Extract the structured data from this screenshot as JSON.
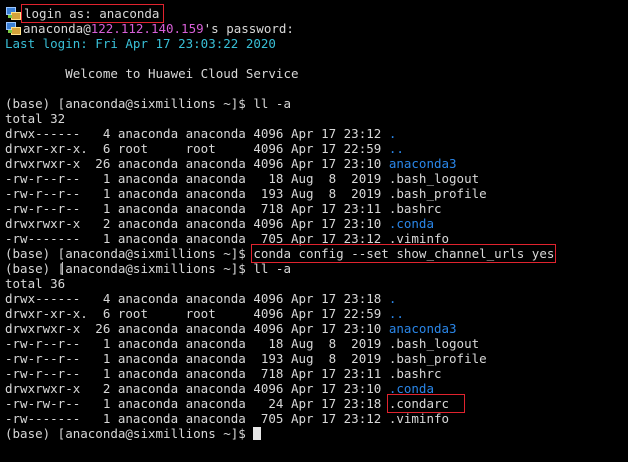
{
  "terminal": {
    "colors": {
      "background": "#000000",
      "text": "#d8d8d8",
      "ip": "#d75fd7",
      "last_login": "#39bfd6",
      "directory": "#2a86e8",
      "highlight_box": "#e0232e"
    },
    "login_line": "login as: anaconda",
    "pw_user": "anaconda@",
    "pw_ip": "122.112.140.159",
    "pw_suffix": "'s password:",
    "last_login": "Last login: Fri Apr 17 23:03:22 2020",
    "welcome": "        Welcome to Huawei Cloud Service",
    "prompt": "(base) [anaconda@sixmillions ~]$ ",
    "cmd1": "ll -a",
    "total1": "total 32",
    "listing1": [
      {
        "meta": "drwx------   4 anaconda anaconda 4096 Apr 17 23:12 ",
        "name": ".",
        "color": "dir"
      },
      {
        "meta": "drwxr-xr-x.  6 root     root     4096 Apr 17 22:59 ",
        "name": "..",
        "color": "dir"
      },
      {
        "meta": "drwxrwxr-x  26 anaconda anaconda 4096 Apr 17 23:10 ",
        "name": "anaconda3",
        "color": "dir"
      },
      {
        "meta": "-rw-r--r--   1 anaconda anaconda   18 Aug  8  2019 ",
        "name": ".bash_logout",
        "color": "plain"
      },
      {
        "meta": "-rw-r--r--   1 anaconda anaconda  193 Aug  8  2019 ",
        "name": ".bash_profile",
        "color": "plain"
      },
      {
        "meta": "-rw-r--r--   1 anaconda anaconda  718 Apr 17 23:11 ",
        "name": ".bashrc",
        "color": "plain"
      },
      {
        "meta": "drwxrwxr-x   2 anaconda anaconda 4096 Apr 17 23:10 ",
        "name": ".conda",
        "color": "dir"
      },
      {
        "meta": "-rw-------   1 anaconda anaconda  705 Apr 17 23:12 ",
        "name": ".viminfo",
        "color": "plain"
      }
    ],
    "cmd2": "conda config --set show_channel_urls yes",
    "cmd3": "ll -a",
    "total2": "total 36",
    "listing2": [
      {
        "meta": "drwx------   4 anaconda anaconda 4096 Apr 17 23:18 ",
        "name": ".",
        "color": "dir"
      },
      {
        "meta": "drwxr-xr-x.  6 root     root     4096 Apr 17 22:59 ",
        "name": "..",
        "color": "dir"
      },
      {
        "meta": "drwxrwxr-x  26 anaconda anaconda 4096 Apr 17 23:10 ",
        "name": "anaconda3",
        "color": "dir"
      },
      {
        "meta": "-rw-r--r--   1 anaconda anaconda   18 Aug  8  2019 ",
        "name": ".bash_logout",
        "color": "plain"
      },
      {
        "meta": "-rw-r--r--   1 anaconda anaconda  193 Aug  8  2019 ",
        "name": ".bash_profile",
        "color": "plain"
      },
      {
        "meta": "-rw-r--r--   1 anaconda anaconda  718 Apr 17 23:11 ",
        "name": ".bashrc",
        "color": "plain"
      },
      {
        "meta": "drwxrwxr-x   2 anaconda anaconda 4096 Apr 17 23:10 ",
        "name": ".conda",
        "color": "dir"
      },
      {
        "meta": "-rw-rw-r--   1 anaconda anaconda   24 Apr 17 23:18 ",
        "name": ".condarc",
        "color": "plain",
        "highlight": true
      },
      {
        "meta": "-rw-------   1 anaconda anaconda  705 Apr 17 23:12 ",
        "name": ".viminfo",
        "color": "plain"
      }
    ]
  }
}
